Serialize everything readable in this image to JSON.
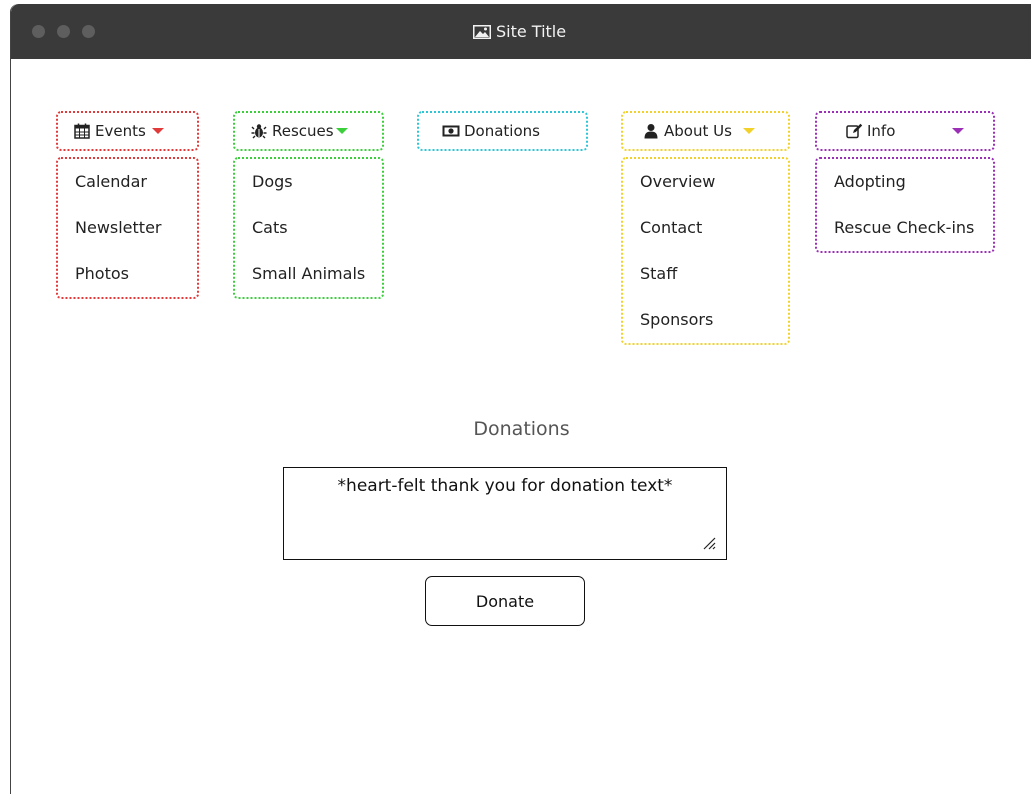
{
  "window": {
    "title": "Site Title"
  },
  "nav": {
    "events": {
      "label": "Events",
      "items": [
        "Calendar",
        "Newsletter",
        "Photos"
      ],
      "color": "#e03a3a"
    },
    "rescues": {
      "label": "Rescues",
      "items": [
        "Dogs",
        "Cats",
        "Small Animals"
      ],
      "color": "#3ccf3c"
    },
    "donations": {
      "label": "Donations",
      "color": "#2cc6d6"
    },
    "about": {
      "label": "About Us",
      "items": [
        "Overview",
        "Contact",
        "Staff",
        "Sponsors"
      ],
      "color": "#f2d22a"
    },
    "info": {
      "label": "Info",
      "items": [
        "Adopting",
        "Rescue Check-ins"
      ],
      "color": "#9b2fb5"
    }
  },
  "donations_section": {
    "title": "Donations",
    "message": "*heart-felt thank you for donation text*",
    "button_label": "Donate"
  },
  "icons": {
    "window": "image-icon",
    "events": "calendar-icon",
    "rescues": "bug-icon",
    "donations": "money-icon",
    "about": "user-icon",
    "info": "edit-icon"
  }
}
